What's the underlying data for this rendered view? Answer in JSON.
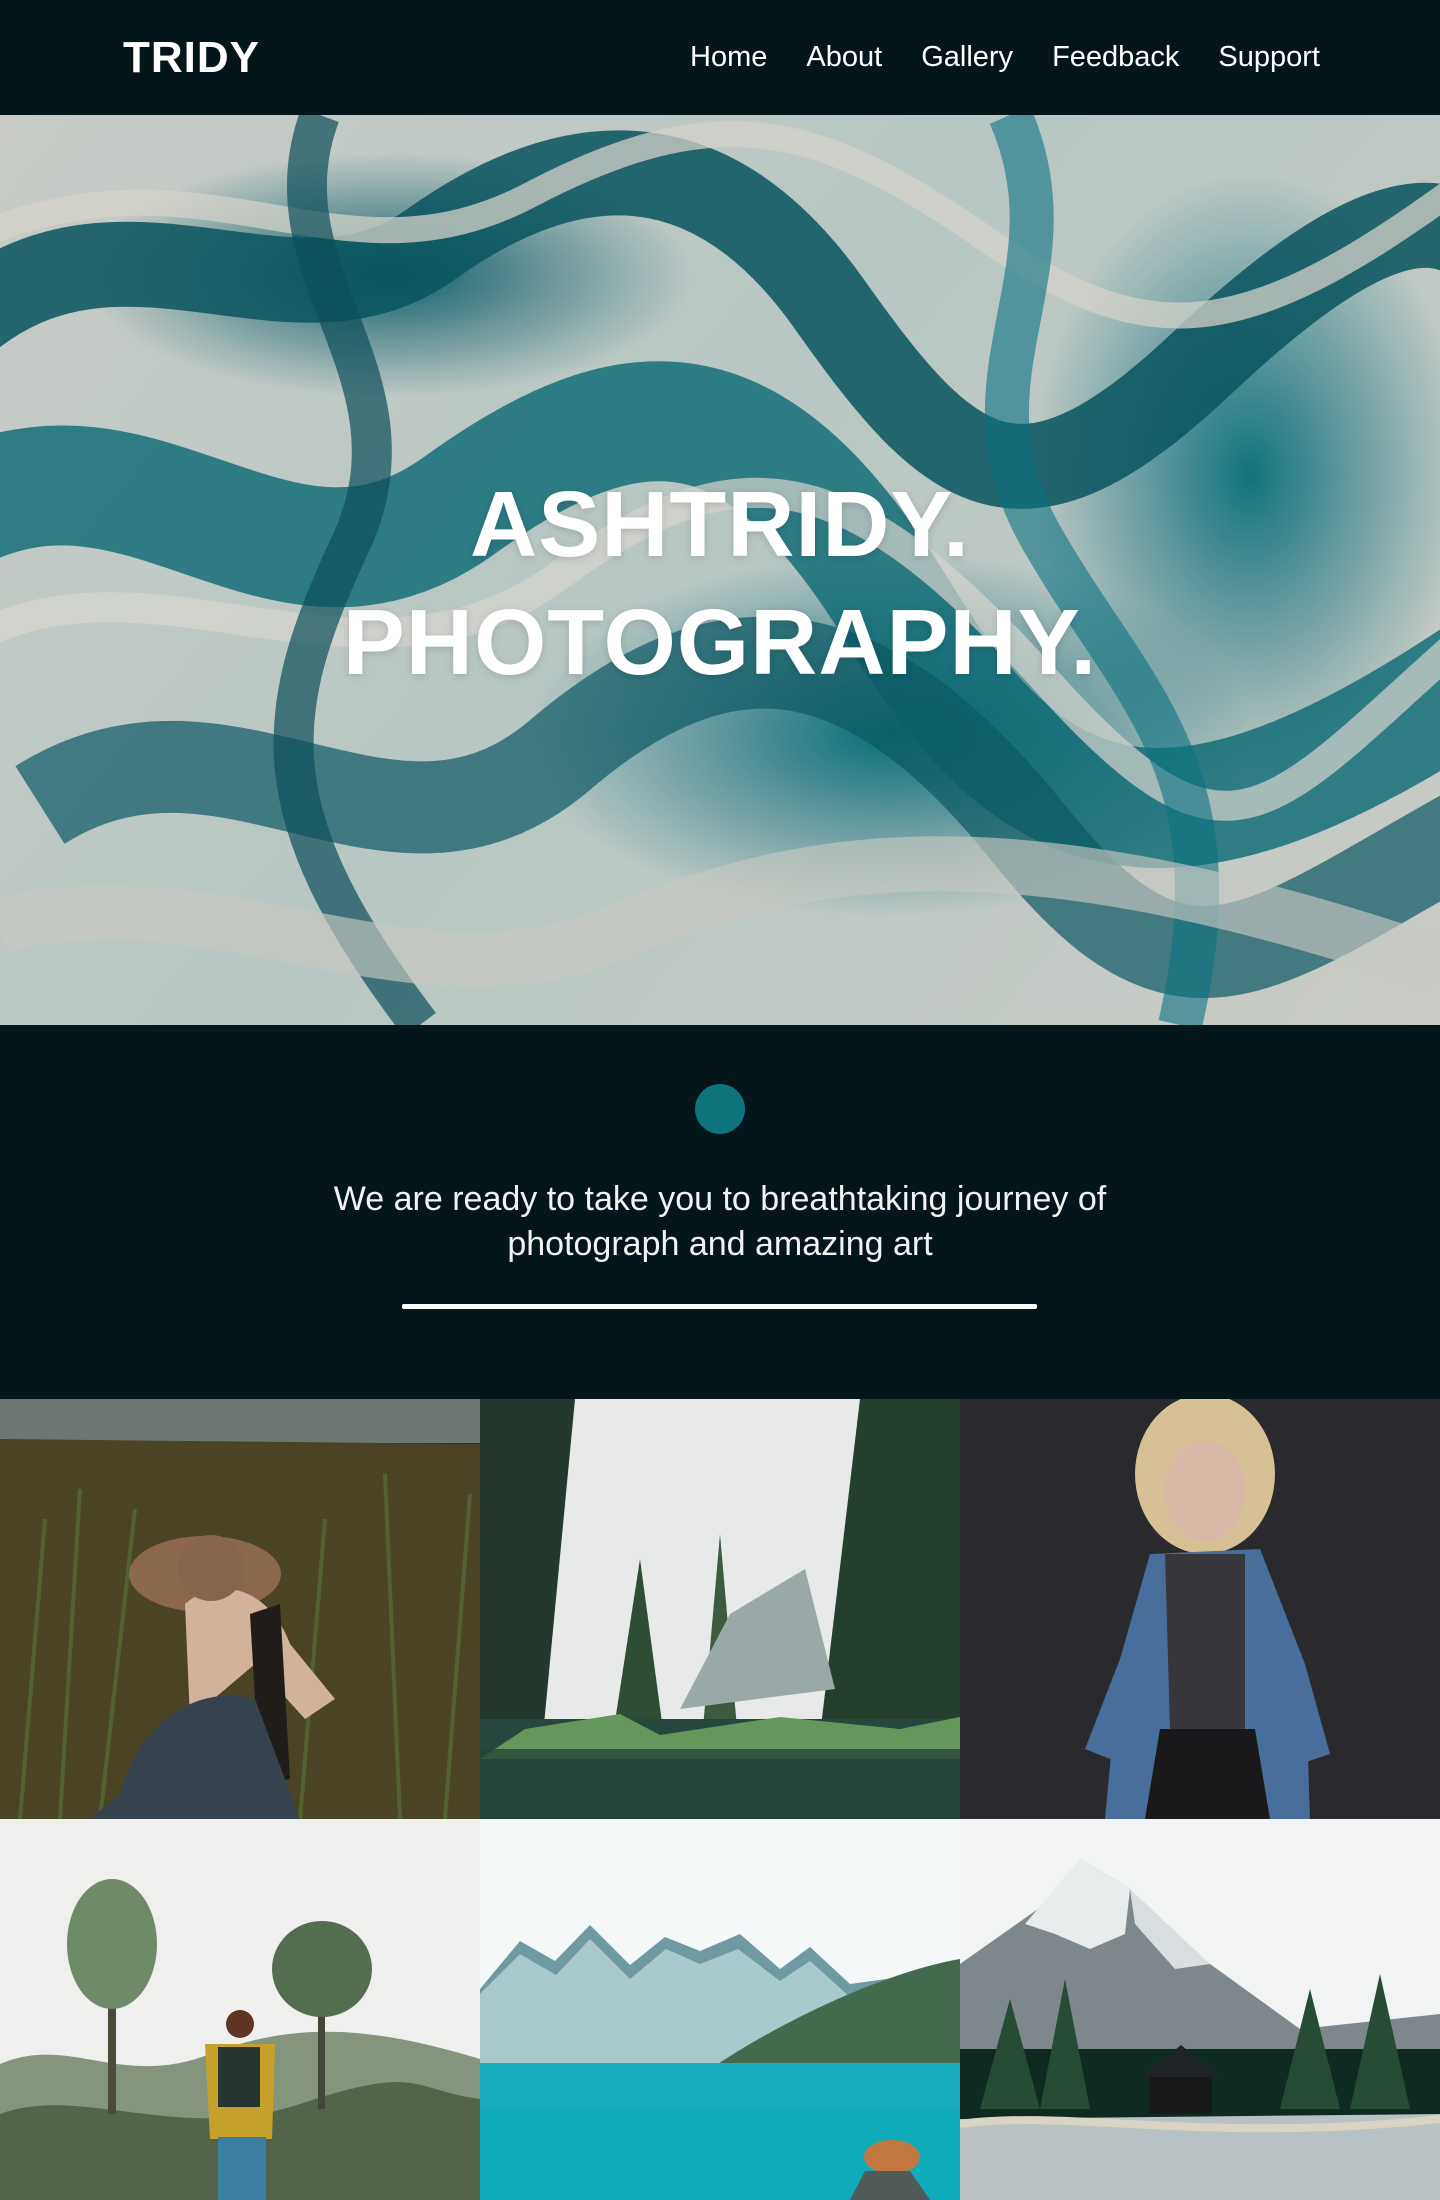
{
  "brand": "TRIDY",
  "nav": {
    "items": [
      {
        "label": "Home"
      },
      {
        "label": "About"
      },
      {
        "label": "Gallery"
      },
      {
        "label": "Feedback"
      },
      {
        "label": "Support"
      }
    ]
  },
  "hero": {
    "title_line_1": "ASHTRIDY.",
    "title_line_2": "PHOTOGRAPHY."
  },
  "intro": {
    "tagline_line_1": "We are ready to take you to breathtaking journey of",
    "tagline_line_2": "photograph and amazing art"
  },
  "gallery": {
    "images": [
      {
        "name": "photographer-in-field-photo"
      },
      {
        "name": "forest-lake-photo"
      },
      {
        "name": "denim-jacket-portrait-photo"
      },
      {
        "name": "hiker-in-misty-forest-photo"
      },
      {
        "name": "turquoise-mountain-lake-photo"
      },
      {
        "name": "mountain-cabin-lake-photo"
      }
    ]
  },
  "colors": {
    "background": "#05161a",
    "accent": "#0f747e",
    "text": "#ffffff"
  }
}
